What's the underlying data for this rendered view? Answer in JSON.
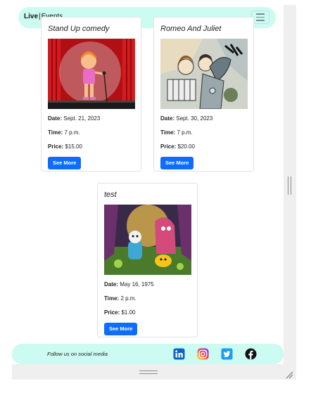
{
  "navbar": {
    "brand_bold": "Live",
    "brand_sep": "|",
    "brand_rest": "Events",
    "menu_icon": "hamburger-icon"
  },
  "events": [
    {
      "title": "Stand Up comedy",
      "image": "stand-up-comedy-illustration",
      "date_label": "Date:",
      "date": "Sept. 21, 2023",
      "time_label": "Time:",
      "time": "7 p.m.",
      "price_label": "Price:",
      "price": "$15.00",
      "button": "See More"
    },
    {
      "title": "Romeo And Juliet",
      "image": "romeo-and-juliet-illustration",
      "date_label": "Date:",
      "date": "Sept. 30, 2023",
      "time_label": "Time:",
      "time": "7 p.m.",
      "price_label": "Price:",
      "price": "$20.00",
      "button": "See More"
    },
    {
      "title": "test",
      "image": "cartoon-characters-illustration",
      "date_label": "Date:",
      "date": "May 16, 1975",
      "time_label": "Time:",
      "time": "2 p.m.",
      "price_label": "Price:",
      "price": "$1.00",
      "button": "See More"
    }
  ],
  "footer": {
    "text": "Follow us on social media",
    "icons": [
      "linkedin-icon",
      "instagram-icon",
      "twitter-icon",
      "facebook-icon"
    ],
    "colors": {
      "linkedin": "#0a66c2",
      "twitter": "#1d9bf0",
      "facebook": "#111111"
    }
  },
  "colors": {
    "accent": "#0d6efd",
    "navbar_bg": "#ccfbf1"
  }
}
